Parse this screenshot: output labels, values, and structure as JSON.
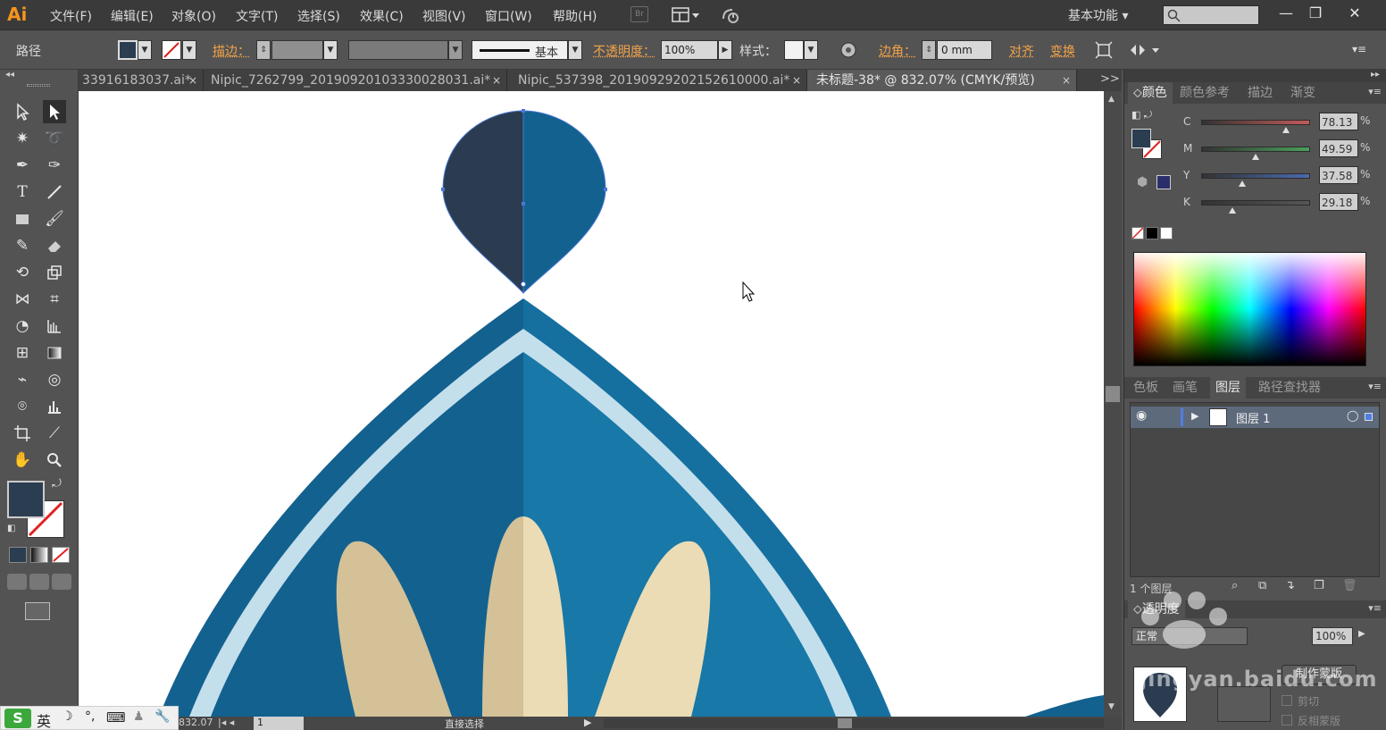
{
  "app": {
    "logo": "Ai"
  },
  "menu": [
    "文件(F)",
    "编辑(E)",
    "对象(O)",
    "文字(T)",
    "选择(S)",
    "效果(C)",
    "视图(V)",
    "窗口(W)",
    "帮助(H)"
  ],
  "bridge_label": "Br",
  "workspace": {
    "label": "基本功能"
  },
  "control": {
    "selection_type": "路径",
    "stroke_label": "描边：",
    "stroke_style": "基本",
    "opacity_label": "不透明度：",
    "opacity_value": "100%",
    "style_label": "样式：",
    "corner_label": "边角：",
    "corner_value": "0 mm",
    "align_label": "对齐",
    "transform_label": "变换"
  },
  "tabs": [
    {
      "label": "33916183037.ai*",
      "close": "×"
    },
    {
      "label": "Nipic_7262799_20190920103330028031.ai*",
      "close": "×"
    },
    {
      "label": "Nipic_537398_20190929202152610000.ai*",
      "close": "×"
    },
    {
      "label": "未标题-38* @ 832.07% (CMYK/预览)",
      "close": "×"
    }
  ],
  "tab_overflow": ">>",
  "color_panel": {
    "tabs": [
      "颜色",
      "颜色参考",
      "描边",
      "渐变"
    ],
    "channels": [
      {
        "name": "C",
        "value": "78.13",
        "pct": "%",
        "pos": 0.78,
        "track": "#c25a5a"
      },
      {
        "name": "M",
        "value": "49.59",
        "pct": "%",
        "pos": 0.5,
        "track": "#4aa05a"
      },
      {
        "name": "Y",
        "value": "37.58",
        "pct": "%",
        "pos": 0.38,
        "track": "#4a6ab0"
      },
      {
        "name": "K",
        "value": "29.18",
        "pct": "%",
        "pos": 0.29,
        "track": "#555555"
      }
    ]
  },
  "layers_panel": {
    "tabs": [
      "色板",
      "画笔",
      "图层",
      "路径查找器"
    ],
    "layer_name": "图层 1",
    "count_label": "1 个图层"
  },
  "transparency_panel": {
    "title": "透明度",
    "mode": "正常",
    "opacity": "100%",
    "make_mask_label": "制作蒙版",
    "clip_label": "剪切",
    "invert_label": "反相蒙版"
  },
  "status": {
    "zoom": "832.07",
    "page": "1",
    "tool_name": "直接选择"
  },
  "ime": {
    "label": "英"
  },
  "watermark": "jingyan.baidu.com",
  "colors": {
    "fill": "#2b3d51",
    "dark_navy": "#2b3c50",
    "deep_blue": "#13618f",
    "mid_blue": "#1878a7",
    "light_blue": "#c3dfec",
    "tan": "#d4c198",
    "cream": "#ebdcb5",
    "selection": "#4a78d4"
  }
}
